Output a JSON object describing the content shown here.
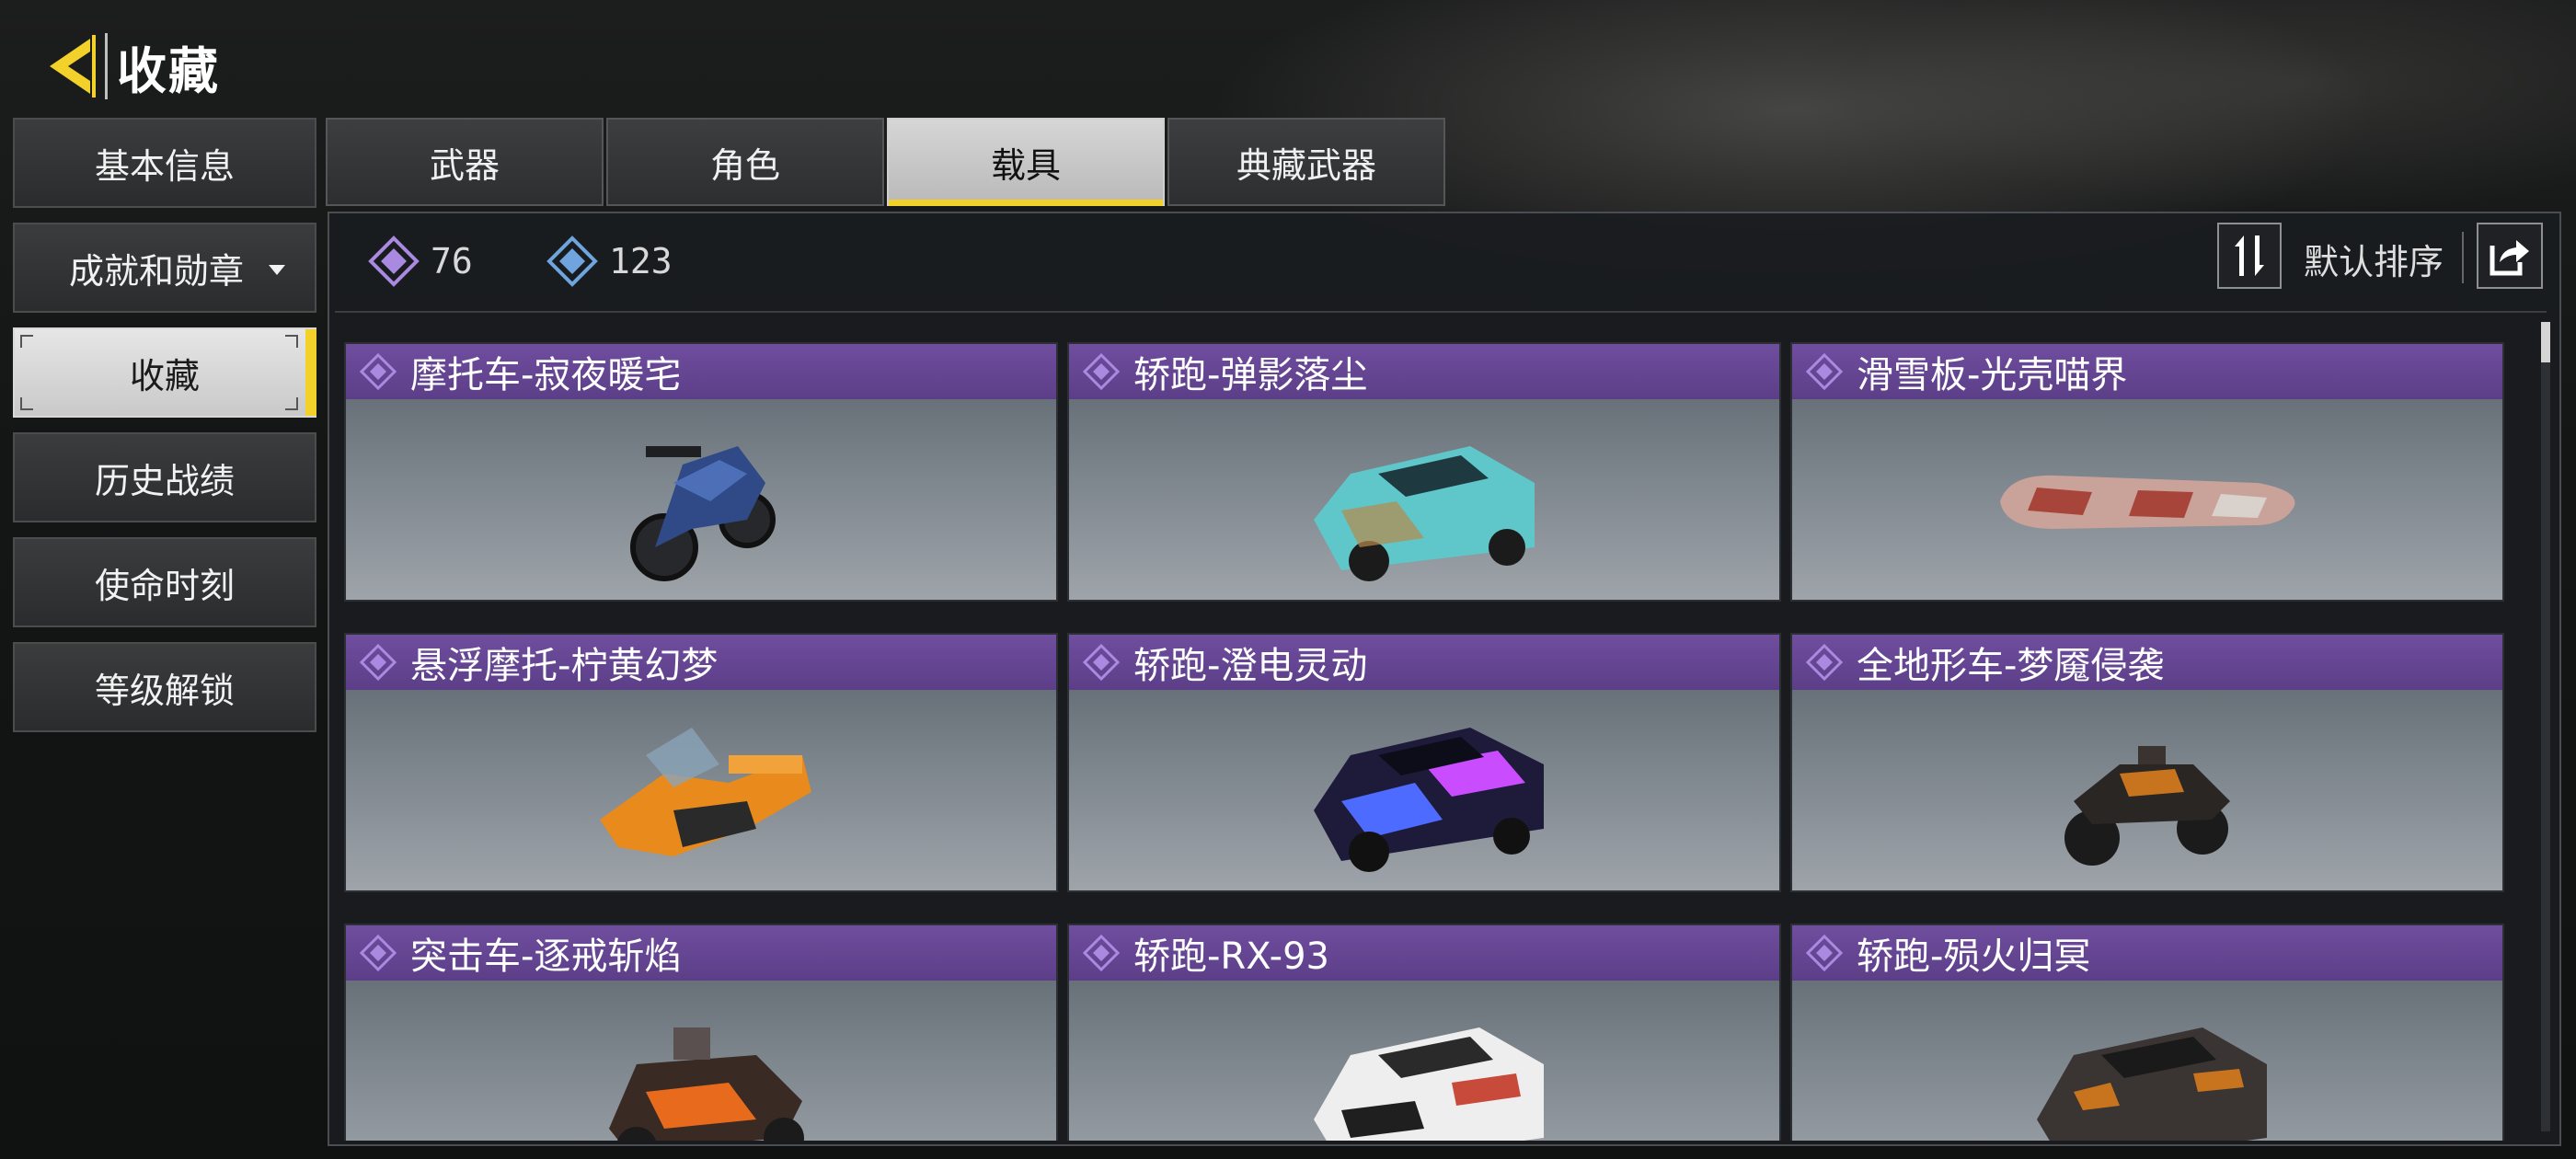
{
  "header": {
    "title": "收藏",
    "back_icon": "back-arrow-icon"
  },
  "colors": {
    "accent": "#f2d12a",
    "rarity_purple": "#6a4b98",
    "panel_bg": "#1a1c20"
  },
  "left_nav": {
    "items": [
      {
        "label": "基本信息",
        "active": false,
        "dropdown": false
      },
      {
        "label": "成就和勋章",
        "active": false,
        "dropdown": true
      },
      {
        "label": "收藏",
        "active": true,
        "dropdown": false
      },
      {
        "label": "历史战绩",
        "active": false,
        "dropdown": false
      },
      {
        "label": "使命时刻",
        "active": false,
        "dropdown": false
      },
      {
        "label": "等级解锁",
        "active": false,
        "dropdown": false
      }
    ]
  },
  "tabs": [
    {
      "label": "武器",
      "active": false
    },
    {
      "label": "角色",
      "active": false
    },
    {
      "label": "载具",
      "active": true
    },
    {
      "label": "典藏武器",
      "active": false
    }
  ],
  "currencies": [
    {
      "icon": "purple-diamond-icon",
      "value": "76"
    },
    {
      "icon": "blue-diamond-icon",
      "value": "123"
    }
  ],
  "toolbar": {
    "sort_label": "默认排序",
    "sort_icon": "sort-arrows-icon",
    "share_icon": "share-icon"
  },
  "items": [
    {
      "name": "摩托车-寂夜暖宅",
      "art": "motorcycle"
    },
    {
      "name": "轿跑-弹影落尘",
      "art": "car-teal"
    },
    {
      "name": "滑雪板-光壳喵界",
      "art": "snowboard"
    },
    {
      "name": "悬浮摩托-柠黄幻梦",
      "art": "hoverbike"
    },
    {
      "name": "轿跑-澄电灵动",
      "art": "car-neon"
    },
    {
      "name": "全地形车-梦魇侵袭",
      "art": "atv"
    },
    {
      "name": "突击车-逐戒斩焰",
      "art": "buggy"
    },
    {
      "name": "轿跑-RX-93",
      "art": "car-white"
    },
    {
      "name": "轿跑-殒火归冥",
      "art": "car-dark"
    }
  ]
}
